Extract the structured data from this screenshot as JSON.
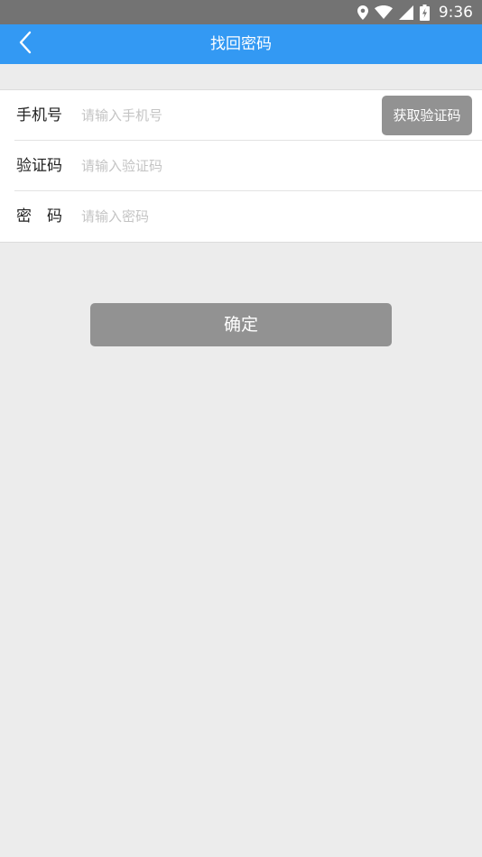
{
  "status_bar": {
    "time": "9:36",
    "icons": [
      "location-icon",
      "wifi-icon",
      "cell-signal-icon",
      "battery-charging-icon"
    ]
  },
  "app_bar": {
    "back_icon": "chevron-left-icon",
    "title": "找回密码"
  },
  "form": {
    "phone": {
      "label": "手机号",
      "placeholder": "请输入手机号",
      "value": "",
      "get_code_label": "获取验证码"
    },
    "code": {
      "label": "验证码",
      "placeholder": "请输入验证码",
      "value": ""
    },
    "password": {
      "label": "密码",
      "placeholder": "请输入密码",
      "value": ""
    }
  },
  "confirm_label": "确定",
  "colors": {
    "app_bar": "#3399f3",
    "status_bar": "#737373",
    "background": "#ececec",
    "button": "#929292"
  }
}
